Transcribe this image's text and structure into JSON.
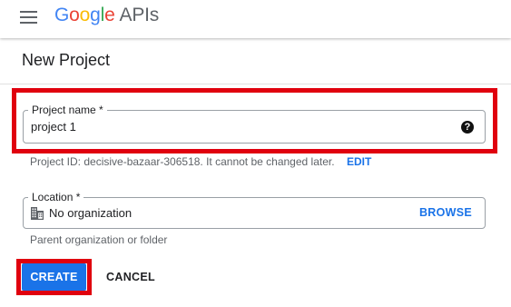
{
  "header": {
    "logo": {
      "letters": [
        "G",
        "o",
        "o",
        "g",
        "l",
        "e"
      ],
      "product": "APIs"
    },
    "menu_icon": "hamburger-menu-icon"
  },
  "page": {
    "title": "New Project"
  },
  "form": {
    "project_name": {
      "label": "Project name *",
      "value": "project 1",
      "help_icon": "help-icon",
      "help_glyph": "?"
    },
    "project_id_hint": "Project ID: decisive-bazaar-306518. It cannot be changed later.",
    "edit_label": "EDIT",
    "location": {
      "label": "Location *",
      "value": "No organization",
      "icon": "building-icon",
      "browse_label": "BROWSE"
    },
    "parent_hint": "Parent organization or folder"
  },
  "actions": {
    "create_label": "CREATE",
    "cancel_label": "CANCEL"
  },
  "colors": {
    "accent": "#1a73e8",
    "highlight": "#e0000e",
    "text": "#202124",
    "muted": "#5f6368"
  }
}
